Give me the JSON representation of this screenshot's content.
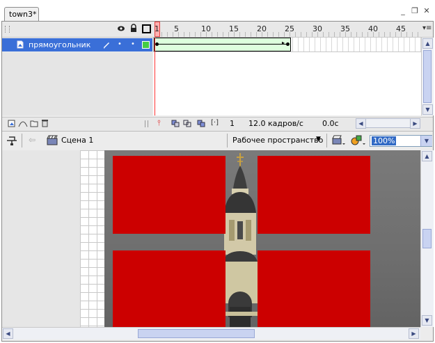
{
  "document": {
    "tab_title": "town3*"
  },
  "window_buttons": {
    "minimize": "_",
    "restore": "❐",
    "close": "✕"
  },
  "timeline": {
    "ruler": [
      "1",
      "5",
      "10",
      "15",
      "20",
      "25",
      "30",
      "35",
      "40",
      "45"
    ],
    "header_icons": [
      "eye-icon",
      "lock-icon",
      "outline-icon"
    ],
    "layers": [
      {
        "name": "прямоугольник",
        "selected": true,
        "color": "#44cc44"
      }
    ],
    "tween_span_frames": [
      1,
      25
    ],
    "current_frame": "1",
    "frame_rate": "12.0 кадров/с",
    "elapsed": "0.0с"
  },
  "edit_bar": {
    "scene": "Сцена 1",
    "workspace": "Рабочее пространство",
    "zoom": "100%"
  },
  "colors": {
    "layer_selected": "#3a6fd8",
    "tween_fill": "#ddffdd",
    "playhead": "#ff3333",
    "rect_red": "#cc0000"
  }
}
